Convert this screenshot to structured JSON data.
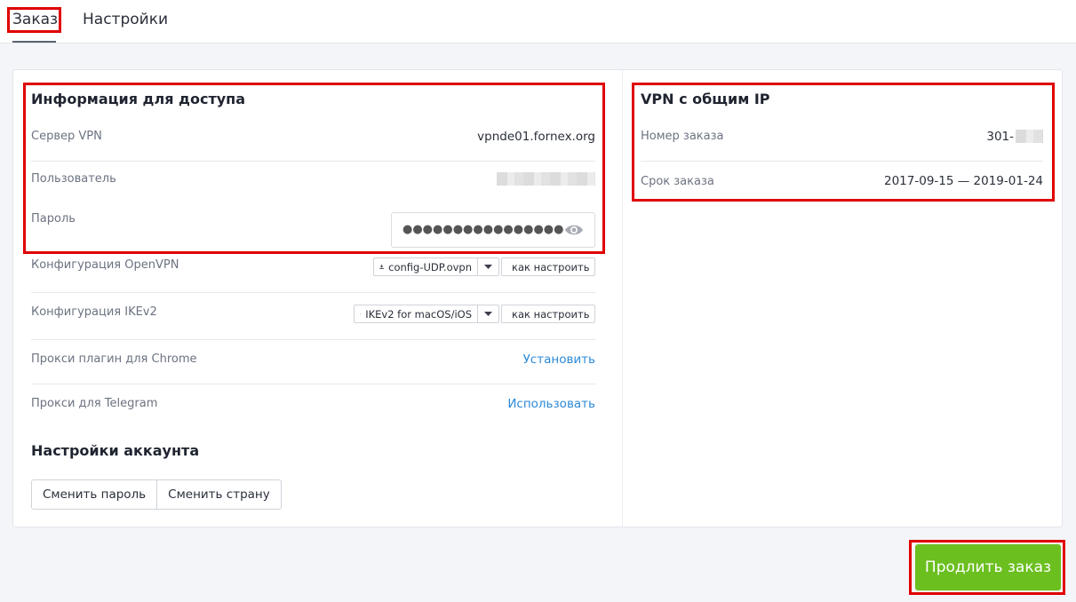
{
  "tabs": {
    "order": "Заказ",
    "settings": "Настройки"
  },
  "access": {
    "title": "Информация для доступа",
    "server_label": "Сервер VPN",
    "server_value": "vpnde01.fornex.org",
    "user_label": "Пользователь",
    "password_label": "Пароль",
    "password_mask": "●●●●●●●●●●●●●●●●",
    "openvpn_label": "Конфигурация OpenVPN",
    "openvpn_button": "config-UDP.ovpn",
    "ikev2_label": "Конфигурация IKEv2",
    "ikev2_button": "IKEv2 for macOS/iOS",
    "howto_label": "как настроить",
    "chrome_label": "Прокси плагин для Chrome",
    "chrome_link": "Установить",
    "telegram_label": "Прокси для Telegram",
    "telegram_link": "Использовать"
  },
  "account": {
    "title": "Настройки аккаунта",
    "change_password": "Сменить пароль",
    "change_country": "Сменить страну"
  },
  "vpn": {
    "title": "VPN с общим IP",
    "order_number_label": "Номер заказа",
    "order_number_prefix": "301-",
    "order_term_label": "Срок заказа",
    "order_term_value": "2017-09-15 — 2019-01-24"
  },
  "renew_button": "Продлить заказ",
  "colors": {
    "accent_green": "#6bbf1f",
    "link_blue": "#2d8ad8",
    "highlight_red": "#e00000"
  }
}
